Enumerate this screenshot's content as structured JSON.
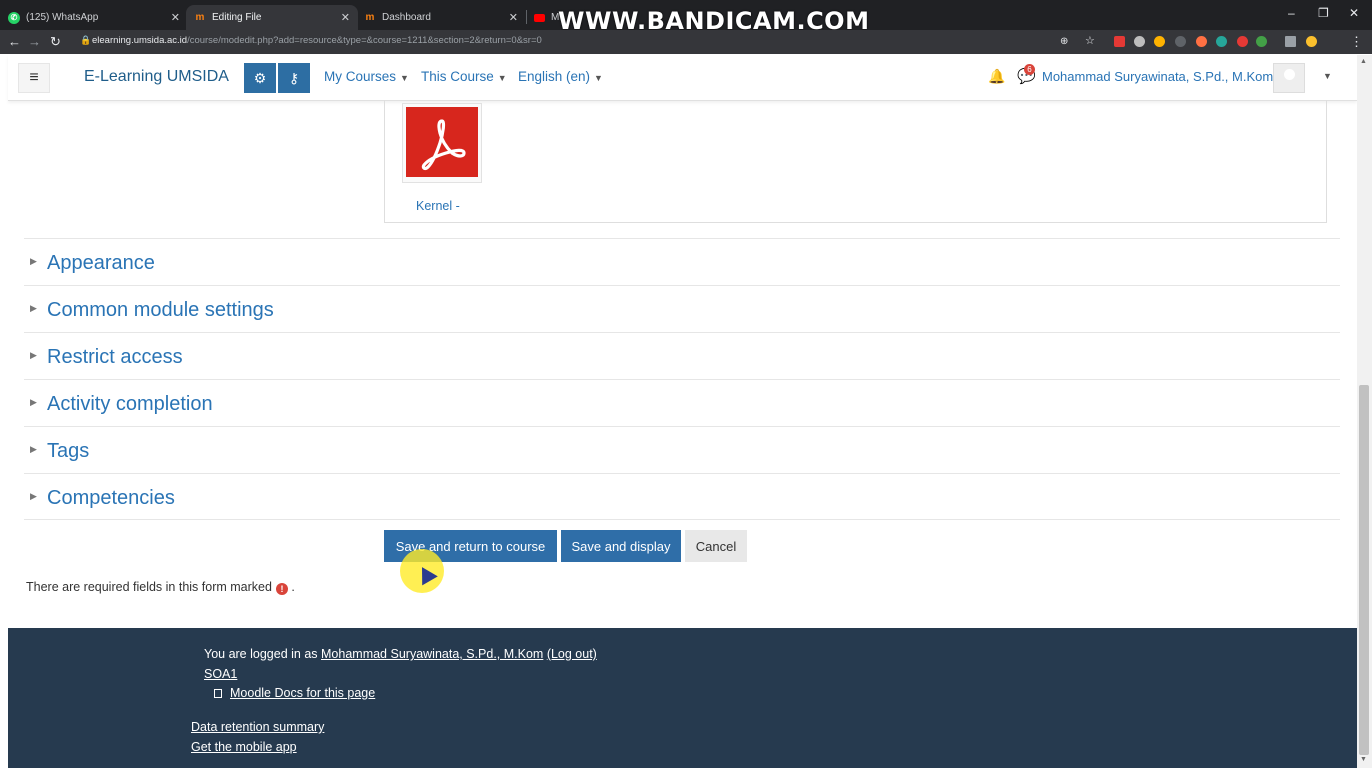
{
  "browser": {
    "tabs": [
      {
        "title": "(125) WhatsApp",
        "active": false
      },
      {
        "title": "Editing File",
        "active": true
      },
      {
        "title": "Dashboard",
        "active": false
      },
      {
        "title": "M",
        "active": false
      }
    ],
    "watermark": "WWW.BANDICAM.COM",
    "url_host": "elearning.umsida.ac.id",
    "url_path": "/course/modedit.php?add=resource&type=&course=1211&section=2&return=0&sr=0"
  },
  "navbar": {
    "brand": "E-Learning UMSIDA",
    "my_courses": "My Courses",
    "this_course": "This Course",
    "language": "English (en)",
    "message_count": "6",
    "user_name": "Mohammad Suryawinata, S.Pd., M.Kom"
  },
  "file": {
    "name": "Kernel -"
  },
  "sections": [
    "Appearance",
    "Common module settings",
    "Restrict access",
    "Activity completion",
    "Tags",
    "Competencies"
  ],
  "buttons": {
    "save_return": "Save and return to course",
    "save_display": "Save and display",
    "cancel": "Cancel"
  },
  "required_note": "There are required fields in this form marked",
  "footer": {
    "logged_in_prefix": "You are logged in as",
    "user": "Mohammad Suryawinata, S.Pd., M.Kom",
    "logout": "(Log out)",
    "course_short": "SOA1",
    "docs": "Moodle Docs for this page",
    "data_retention": "Data retention summary",
    "mobile_app": "Get the mobile app"
  },
  "colors": {
    "primary": "#2f6ea8",
    "link": "#2a74b5",
    "footer_bg": "#263a4f",
    "pdf_red": "#d7261d"
  }
}
